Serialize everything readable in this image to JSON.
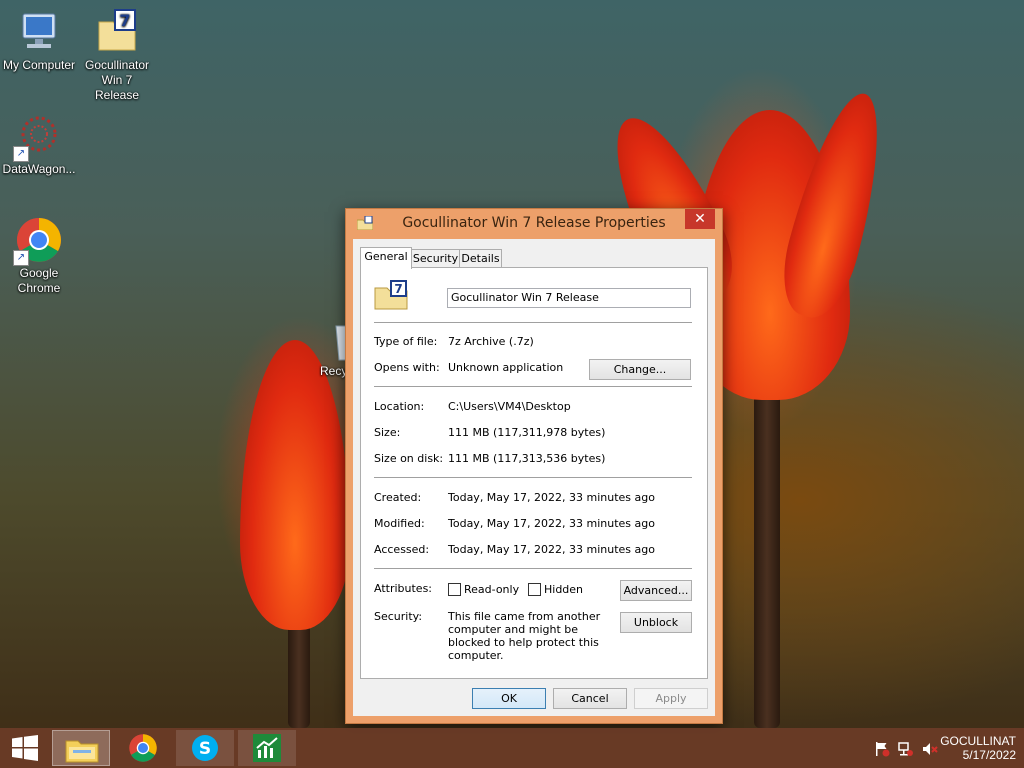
{
  "desktop": {
    "icons": [
      {
        "label": "My Computer"
      },
      {
        "label": "Gocullinator Win 7 Release"
      },
      {
        "label": "DataWagon..."
      },
      {
        "label": "Google Chrome"
      },
      {
        "label": "Recy"
      }
    ]
  },
  "dialog": {
    "title": "Gocullinator Win 7 Release Properties",
    "close_glyph": "✕",
    "tabs": [
      {
        "label": "General",
        "active": true
      },
      {
        "label": "Security",
        "active": false
      },
      {
        "label": "Details",
        "active": false
      }
    ],
    "general": {
      "file_name": "Gocullinator Win 7 Release",
      "type_label": "Type of file:",
      "type_value": "7z Archive (.7z)",
      "opens_label": "Opens with:",
      "opens_value": "Unknown application",
      "change_button": "Change...",
      "location_label": "Location:",
      "location_value": "C:\\Users\\VM4\\Desktop",
      "size_label": "Size:",
      "size_value": "111 MB (117,311,978 bytes)",
      "size_on_disk_label": "Size on disk:",
      "size_on_disk_value": "111 MB (117,313,536 bytes)",
      "created_label": "Created:",
      "created_value": "Today, May 17, 2022, 33 minutes ago",
      "modified_label": "Modified:",
      "modified_value": "Today, May 17, 2022, 33 minutes ago",
      "accessed_label": "Accessed:",
      "accessed_value": "Today, May 17, 2022, 33 minutes ago",
      "attributes_label": "Attributes:",
      "readonly_label": "Read-only",
      "hidden_label": "Hidden",
      "advanced_button": "Advanced...",
      "security_label": "Security:",
      "security_text": "This file came from another computer and might be blocked to help protect this computer.",
      "unblock_button": "Unblock"
    },
    "buttons": {
      "ok": "OK",
      "cancel": "Cancel",
      "apply": "Apply"
    }
  },
  "taskbar": {
    "pinned": [
      "file-explorer",
      "chrome",
      "skype",
      "chart-app"
    ],
    "tray": {
      "label": "GOCULLINAT",
      "date": "5/17/2022"
    }
  },
  "colors": {
    "dialog_frame": "#eda06a",
    "close_button": "#c7372a",
    "taskbar": "#6e3c28"
  }
}
